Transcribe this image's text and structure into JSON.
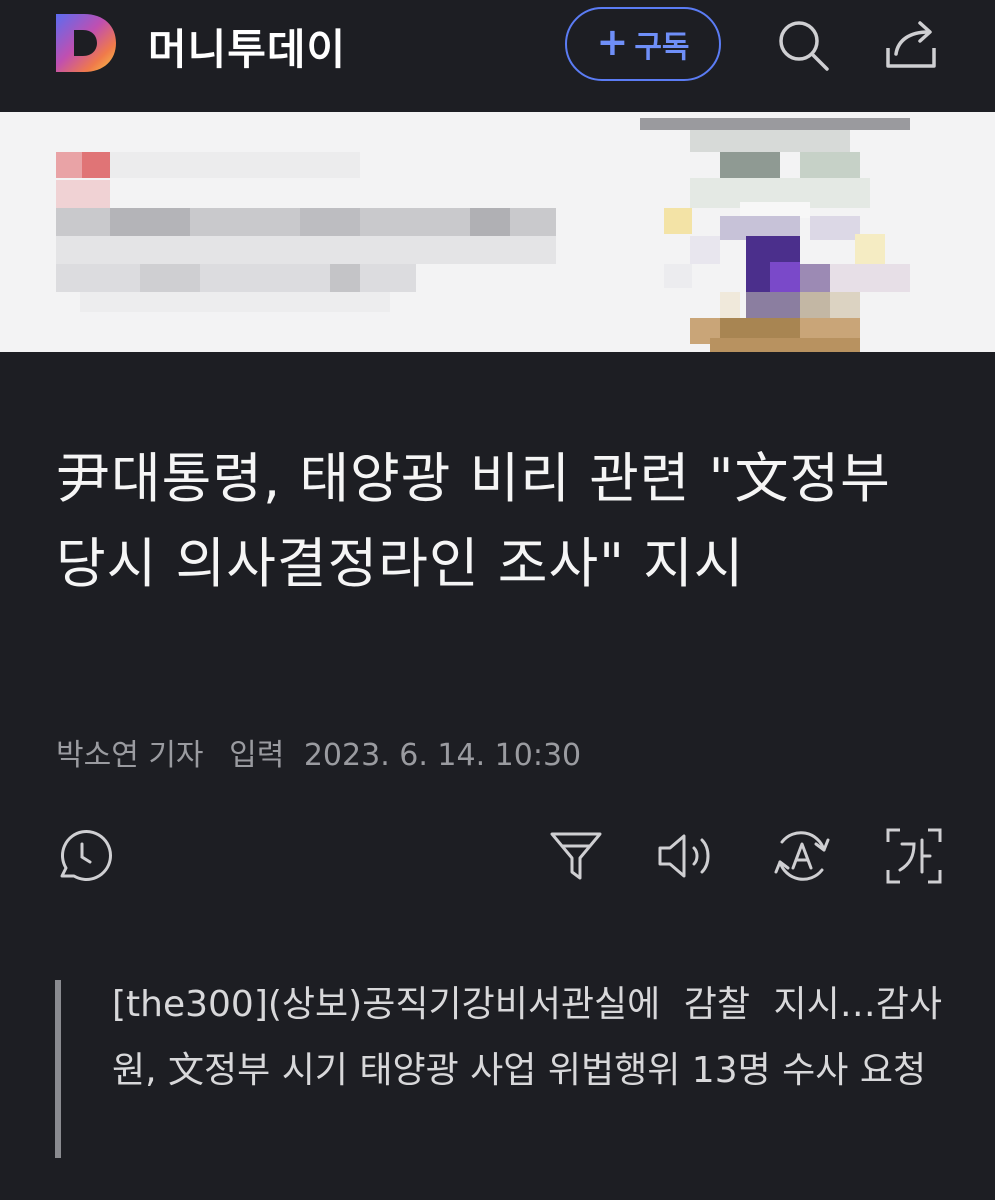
{
  "header": {
    "brand": "머니투데이",
    "logo_letter": "D",
    "subscribe_label": "구독",
    "icons": [
      "search-icon",
      "share-icon"
    ]
  },
  "article": {
    "headline": "尹대통령, 태양광 비리 관련 \"文정부 당시 의사결정라인 조사\" 지시",
    "byline": {
      "author": "박소연 기자",
      "input_label": "입력",
      "datetime": "2023. 6. 14. 10:30"
    },
    "summary": "[the300](상보)공직기강비서관실에 감찰 지시…감사원, 文정부 시기 태양광 사업 위법행위 13명 수사 요청"
  },
  "toolbar": {
    "icons": [
      "history-icon",
      "filter-icon",
      "speaker-icon",
      "translate-icon",
      "font-size-icon"
    ]
  },
  "colors": {
    "background": "#1d1e23",
    "accent": "#5b7cf4",
    "muted_text": "#9a9ba0"
  }
}
